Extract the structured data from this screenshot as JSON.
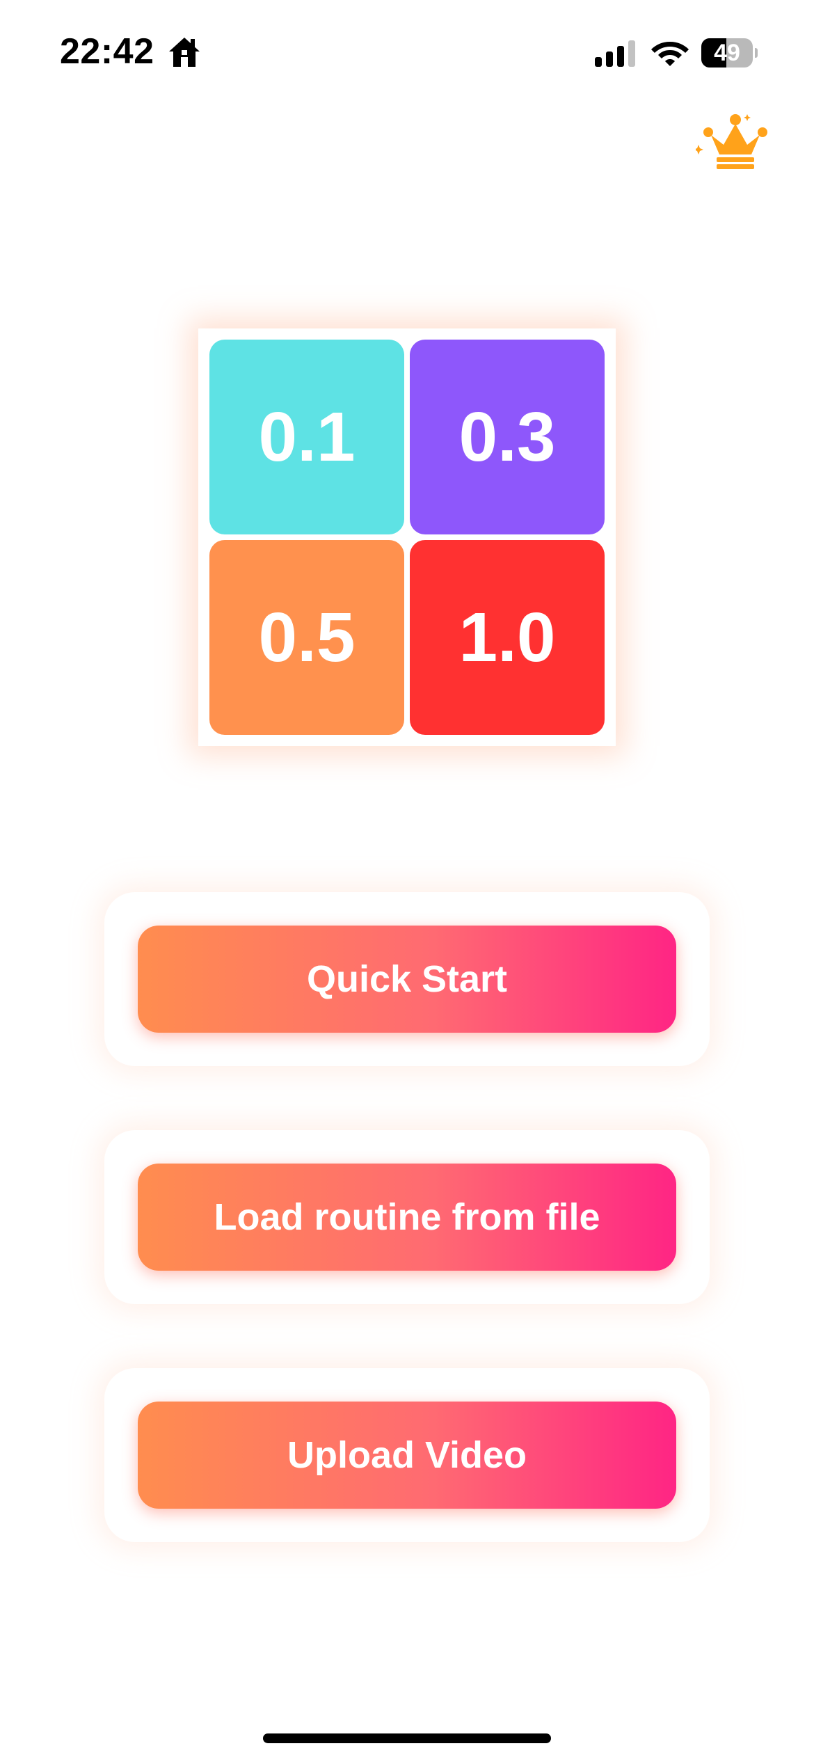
{
  "status_bar": {
    "time": "22:42",
    "home_icon": "house-icon",
    "signal_icon": "cellular-signal-icon",
    "wifi_icon": "wifi-icon",
    "battery_level": "49",
    "battery_fraction": 0.49
  },
  "header": {
    "premium_icon": "crown-icon",
    "premium_color": "#FFA21A"
  },
  "logo_grid": {
    "cells": [
      {
        "label": "0.1",
        "color": "#5EE2E4"
      },
      {
        "label": "0.3",
        "color": "#8E57FB"
      },
      {
        "label": "0.5",
        "color": "#FF914E"
      },
      {
        "label": "1.0",
        "color": "#FF3131"
      }
    ]
  },
  "actions": {
    "quick_start": "Quick Start",
    "load_routine": "Load routine from file",
    "upload_video": "Upload Video"
  },
  "colors": {
    "button_gradient_start": "#FF8D4F",
    "button_gradient_end": "#FF2584"
  }
}
